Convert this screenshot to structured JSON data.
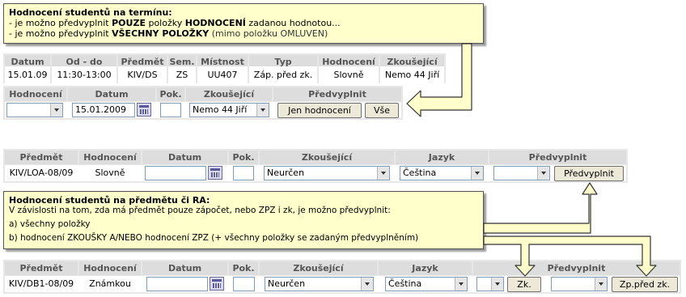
{
  "tip1": {
    "title": "Hodnocení studentů na termínu:",
    "line1_a": "- je možno předvyplnit ",
    "line1_b": "POUZE",
    "line1_c": " položky ",
    "line1_d": "HODNOCENÍ",
    "line1_e": " zadanou hodnotou...",
    "line2_a": "- je možno předvyplnit ",
    "line2_b": "VŠECHNY POLOŽKY",
    "line2_c": " (mimo položku OMLUVEN)"
  },
  "term_table": {
    "headers": [
      "Datum",
      "Od - do",
      "Předmět",
      "Sem.",
      "Místnost",
      "Typ",
      "Hodnocení",
      "Zkoušející"
    ],
    "row": [
      "15.01.09",
      "11:30-13:00",
      "KIV/DS",
      "ZS",
      "UU407",
      "Záp. před zk.",
      "Slovně",
      "Nemo 44 Jiří"
    ]
  },
  "term_form": {
    "headers": {
      "hodnoceni": "Hodnocení",
      "datum": "Datum",
      "pok": "Pok.",
      "zkousejici": "Zkoušející",
      "predvyplnit": "Předvyplnit"
    },
    "hodnoceni_value": "",
    "datum_value": "15.01.2009",
    "pok_value": "",
    "zkousejici_value": "Nemo 44 Jiří",
    "btn_jen": "Jen hodnocení",
    "btn_vse": "Vše"
  },
  "subj1": {
    "headers": {
      "predmet": "Předmět",
      "hodnoceni": "Hodnocení",
      "datum": "Datum",
      "pok": "Pok.",
      "zkousejici": "Zkoušející",
      "jazyk": "Jazyk",
      "predvyplnit": "Předvyplnit"
    },
    "predmet": "KIV/LOA-08/09",
    "hodnoceni": "Slovně",
    "datum_value": "",
    "pok_value": "",
    "zkousejici_value": "Neurčen",
    "jazyk_value": "Čeština",
    "pred_value": "",
    "btn_pred": "Předvyplnit"
  },
  "tip2": {
    "title": "Hodnocení studentů na předmětu či RA:",
    "line1": "V závislosti na tom, zda má předmět pouze zápočet, nebo ZPZ i zk, je možno předvyplnit:",
    "line2": "a) všechny položky",
    "line3": "b) hodnocení ZKOUŠKY A/NEBO hodnocení ZPZ (+ všechny položky se zadaným předvyplněním)"
  },
  "subj2": {
    "headers": {
      "predmet": "Předmět",
      "hodnoceni": "Hodnocení",
      "datum": "Datum",
      "pok": "Pok.",
      "zkousejici": "Zkoušející",
      "jazyk": "Jazyk",
      "predvyplnit": "Předvyplnit"
    },
    "predmet": "KIV/DB1-08/09",
    "hodnoceni": "Známkou",
    "datum_value": "",
    "pok_value": "",
    "zkousejici_value": "Neurčen",
    "jazyk_value": "Čeština",
    "zk_select": "",
    "btn_zk": "Zk.",
    "zpz_select": "",
    "btn_zpz": "Zp.před zk."
  },
  "colors": {
    "tooltip_bg": "#ffffcc",
    "header_bg": "#dddddd",
    "band_bg": "#e7e7e7",
    "arrow_fill": "#ffffcc"
  }
}
